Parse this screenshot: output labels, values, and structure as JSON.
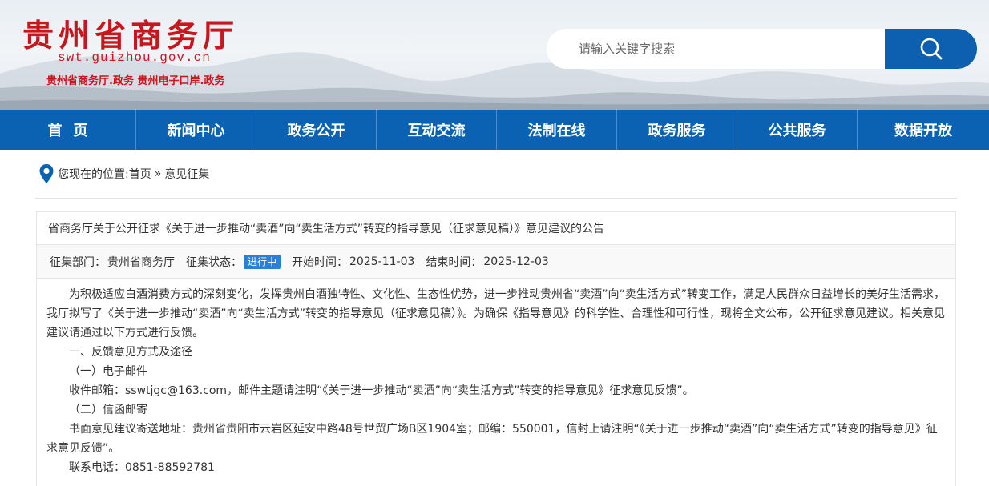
{
  "header": {
    "logo_title": "贵州省商务厅",
    "logo_domain": "swt.guizhou.gov.cn",
    "logo_sub": "贵州省商务厅.政务  贵州电子口岸.政务",
    "search_placeholder": "请输入关键字搜索",
    "search_icon": "search-icon"
  },
  "colors": {
    "brand_red": "#c8161d",
    "nav_blue": "#0b62b3",
    "search_blue": "#0d5fb0",
    "status_blue": "#2b7fd6"
  },
  "nav": {
    "items": [
      {
        "label": "首页"
      },
      {
        "label": "新闻中心"
      },
      {
        "label": "政务公开"
      },
      {
        "label": "互动交流"
      },
      {
        "label": "法制在线"
      },
      {
        "label": "政务服务"
      },
      {
        "label": "公共服务"
      },
      {
        "label": "数据开放"
      }
    ]
  },
  "breadcrumb": {
    "prefix": "您现在的位置:",
    "home": "首页",
    "separator": "»",
    "current": "意见征集",
    "icon": "location-pin-icon"
  },
  "notice": {
    "title": "省商务厅关于公开征求《关于进一步推动“卖酒”向“卖生活方式”转变的指导意见（征求意见稿）》意见建议的公告",
    "dept_label": "征集部门：",
    "dept_value": "贵州省商务厅",
    "status_label": "征集状态：",
    "status_value": "进行中",
    "start_label": "开始时间：",
    "start_value": "2025-11-03",
    "end_label": "结束时间：",
    "end_value": "2025-12-03"
  },
  "content": {
    "para1": "为积极适应白酒消费方式的深刻变化，发挥贵州白酒独特性、文化性、生态性优势，进一步推动贵州省“卖酒”向“卖生活方式”转变工作，满足人民群众日益增长的美好生活需求，我厅拟写了《关于进一步推动“卖酒”向“卖生活方式”转变的指导意见（征求意见稿）》。为确保《指导意见》的科学性、合理性和可行性，现将全文公布，公开征求意见建议。相关意见建议请通过以下方式进行反馈。",
    "section1": "一、反馈意见方式及途径",
    "sub1": "（一）电子邮件",
    "email_line": "收件邮箱：sswtjgc@163.com，邮件主题请注明“《关于进一步推动“卖酒”向“卖生活方式”转变的指导意见》征求意见反馈”。",
    "sub2": "（二）信函邮寄",
    "mail_line": "书面意见建议寄送地址：贵州省贵阳市云岩区延安中路48号世贸广场B区1904室；邮编：550001，信封上请注明“《关于进一步推动“卖酒”向“卖生活方式”转变的指导意见》征求意见反馈”。",
    "phone_line": "联系电话：0851-88592781"
  }
}
